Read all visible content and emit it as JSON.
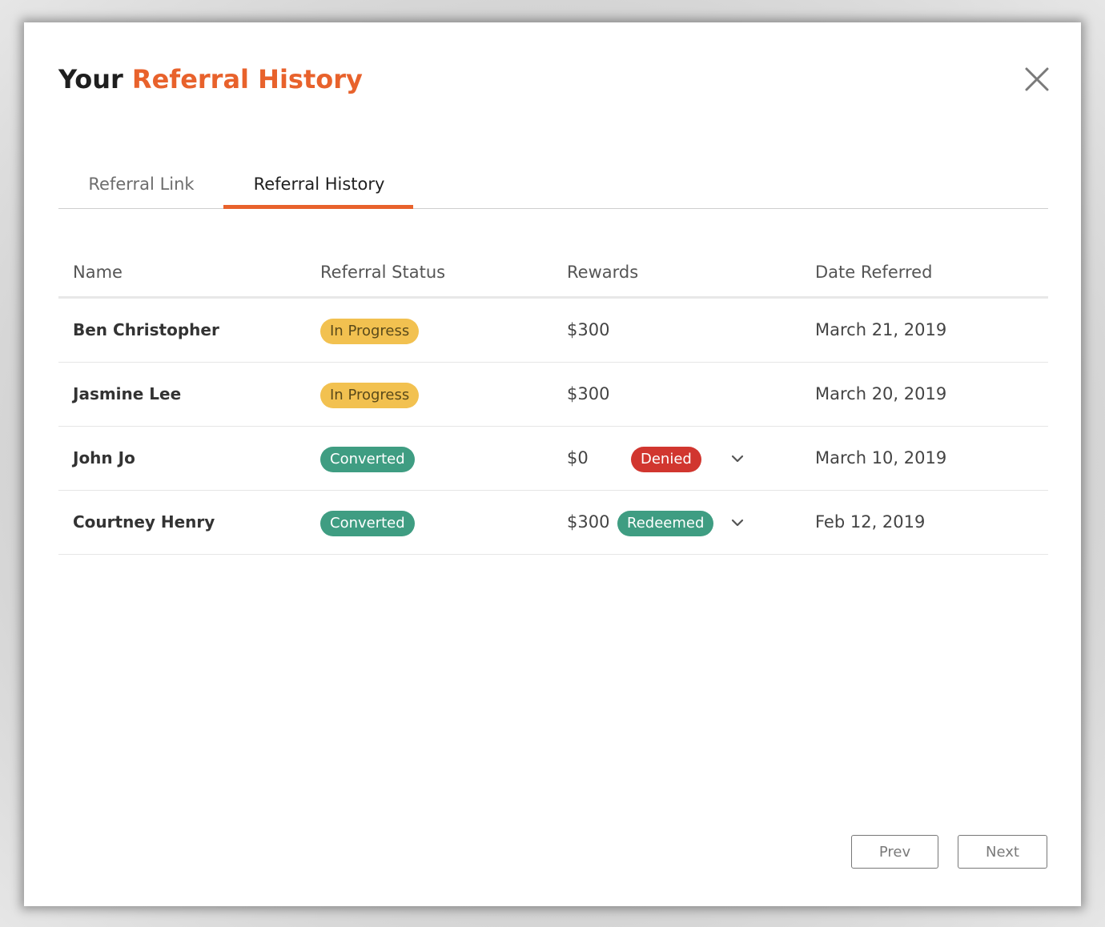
{
  "modal": {
    "title_prefix": "Your",
    "title_accent": "Referral History",
    "accent_color": "#e8622c"
  },
  "tabs": [
    {
      "label": "Referral Link",
      "active": false
    },
    {
      "label": "Referral History",
      "active": true
    }
  ],
  "table": {
    "headers": [
      "Name",
      "Referral Status",
      "Rewards",
      "Date Referred"
    ],
    "rows": [
      {
        "name": "Ben Christopher",
        "status": "In Progress",
        "reward": "$300",
        "reward_status": "",
        "date": "March 21, 2019"
      },
      {
        "name": "Jasmine Lee",
        "status": "In Progress",
        "reward": "$300",
        "reward_status": "",
        "date": "March 20, 2019"
      },
      {
        "name": "John Jo",
        "status": "Converted",
        "reward": "$0",
        "reward_status": "Denied",
        "date": "March 10, 2019"
      },
      {
        "name": "Courtney Henry",
        "status": "Converted",
        "reward": "$300",
        "reward_status": "Redeemed",
        "date": "Feb 12, 2019"
      }
    ]
  },
  "pagination": {
    "prev_label": "Prev",
    "next_label": "Next"
  },
  "colors": {
    "in_progress": "#f2c150",
    "converted": "#3f9d82",
    "denied": "#d1362f",
    "redeemed": "#3f9d82"
  },
  "icons": {
    "close": "close-icon",
    "expand": "chevron-down-icon"
  }
}
